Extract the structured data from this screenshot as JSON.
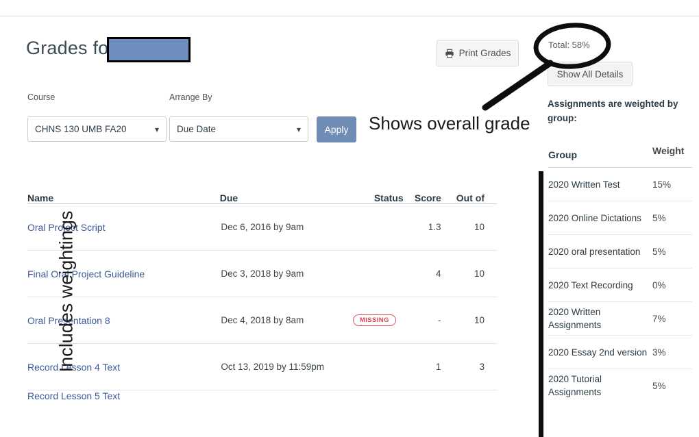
{
  "header": {
    "title": "Grades for",
    "redacted_name": "",
    "print_label": "Print Grades",
    "print_icon": "printer-icon",
    "total_label": "Total: 58%",
    "show_details_label": "Show All Details",
    "weighted_note": "Assignments are weighted by group:"
  },
  "filters": {
    "course_label": "Course",
    "arrange_label": "Arrange By",
    "course_value": "CHNS 130 UMB FA20",
    "arrange_value": "Due Date",
    "apply_label": "Apply",
    "caret_icon": "chevron-down-icon"
  },
  "grades_table": {
    "columns": [
      "Name",
      "Due",
      "Status",
      "Score",
      "Out of"
    ],
    "rows": [
      {
        "name": "Oral Project Script",
        "due": "Dec 6, 2016 by 9am",
        "status": "",
        "score": "1.3",
        "out_of": "10"
      },
      {
        "name": "Final Oral Project Guideline",
        "due": "Dec 3, 2018 by 9am",
        "status": "",
        "score": "4",
        "out_of": "10"
      },
      {
        "name": "Oral Presentation 8",
        "due": "Dec 4, 2018 by 8am",
        "status": "MISSING",
        "score": "-",
        "out_of": "10"
      },
      {
        "name": "Record Lesson 4 Text",
        "due": "Oct 13, 2019 by 11:59pm",
        "status": "",
        "score": "1",
        "out_of": "3"
      },
      {
        "name": "Record Lesson 5 Text",
        "due": "",
        "status": "",
        "score": "",
        "out_of": ""
      }
    ]
  },
  "weights_table": {
    "columns": [
      "Group",
      "Weight"
    ],
    "rows": [
      {
        "group": "2020 Written Test",
        "weight": "15%"
      },
      {
        "group": "2020 Online Dictations",
        "weight": "5%"
      },
      {
        "group": "2020 oral presentation",
        "weight": "5%"
      },
      {
        "group": "2020 Text Recording",
        "weight": "0%"
      },
      {
        "group": "2020 Written Assignments",
        "weight": "7%"
      },
      {
        "group": "2020 Essay 2nd version",
        "weight": "3%"
      },
      {
        "group": "2020 Tutorial Assignments",
        "weight": "5%"
      }
    ]
  },
  "annotations": {
    "overall_grade_note": "Shows overall grade",
    "weightings_note": "Includes weightings"
  },
  "colors": {
    "accent_blue": "#6f8cb5",
    "redaction_blue": "#6e8fbe",
    "link_blue": "#3b5998",
    "missing_red": "#d9454e",
    "annotation_black": "#1b1b1b"
  }
}
